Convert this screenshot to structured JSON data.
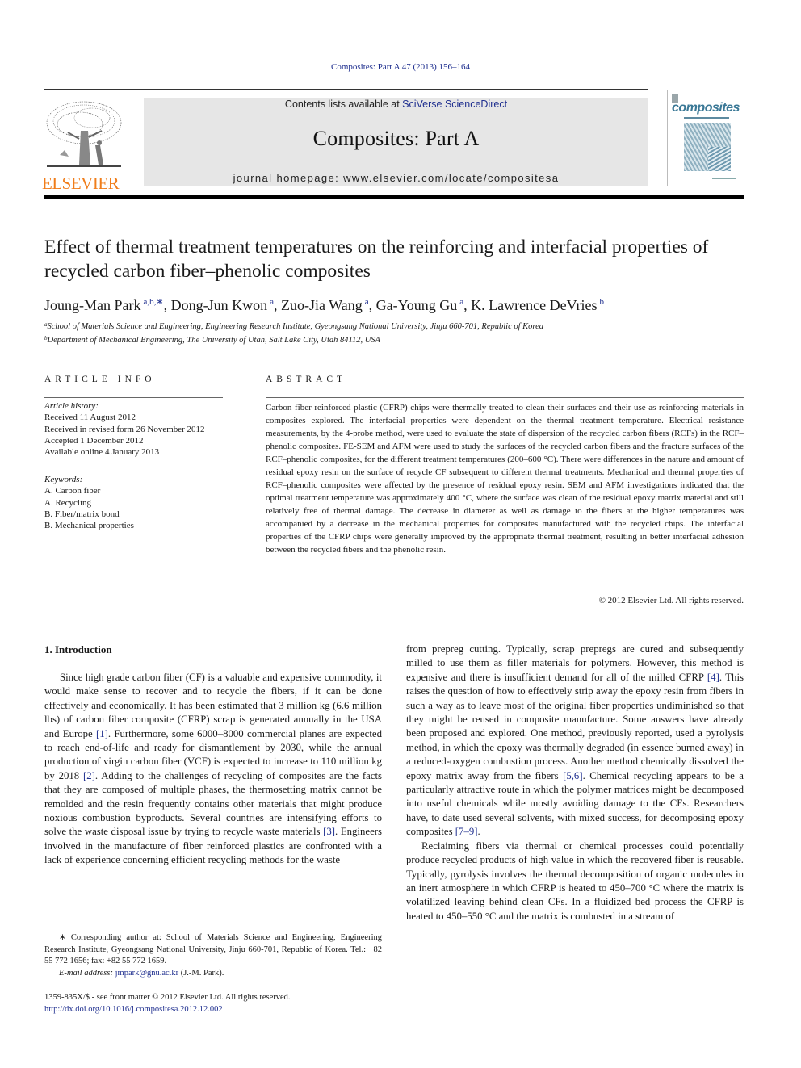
{
  "header": {
    "citation": "Composites: Part A 47 (2013) 156–164",
    "contents_prefix": "Contents lists available at ",
    "contents_link": "SciVerse ScienceDirect",
    "journal_title": "Composites: Part A",
    "homepage_prefix": "journal homepage: ",
    "homepage_url": "www.elsevier.com/locate/compositesa",
    "publisher_logo_text": "ELSEVIER",
    "cover_title": "composites",
    "colors": {
      "link": "#1f2f8f",
      "elsevier_orange": "#f07d1a",
      "masthead_bg": "#e6e6e6",
      "cover_accent": "#3a7896"
    }
  },
  "article": {
    "title": "Effect of thermal treatment temperatures on the reinforcing and interfacial properties of recycled carbon fiber–phenolic composites",
    "authors": [
      {
        "name": "Joung-Man Park",
        "affil": "a,b,∗",
        "sep": ", "
      },
      {
        "name": "Dong-Jun Kwon",
        "affil": "a",
        "sep": ", "
      },
      {
        "name": "Zuo-Jia Wang",
        "affil": "a",
        "sep": ", "
      },
      {
        "name": "Ga-Young Gu",
        "affil": "a",
        "sep": ", "
      },
      {
        "name": "K. Lawrence DeVries",
        "affil": "b",
        "sep": ""
      }
    ],
    "affiliations": [
      {
        "mark": "a",
        "text": "School of Materials Science and Engineering, Engineering Research Institute, Gyeongsang National University, Jinju 660-701, Republic of Korea"
      },
      {
        "mark": "b",
        "text": "Department of Mechanical Engineering, The University of Utah, Salt Lake City, Utah 84112, USA"
      }
    ]
  },
  "article_info": {
    "heading": "ARTICLE INFO",
    "history_label": "Article history:",
    "history": [
      "Received 11 August 2012",
      "Received in revised form 26 November 2012",
      "Accepted 1 December 2012",
      "Available online 4 January 2013"
    ],
    "keywords_label": "Keywords:",
    "keywords": [
      "A. Carbon fiber",
      "A. Recycling",
      "B. Fiber/matrix bond",
      "B. Mechanical properties"
    ]
  },
  "abstract": {
    "heading": "ABSTRACT",
    "text": "Carbon fiber reinforced plastic (CFRP) chips were thermally treated to clean their surfaces and their use as reinforcing materials in composites explored. The interfacial properties were dependent on the thermal treatment temperature. Electrical resistance measurements, by the 4-probe method, were used to eval­uate the state of dispersion of the recycled carbon fibers (RCFs) in the RCF–phenolic composites. FE-SEM and AFM were used to study the surfaces of the recycled carbon fibers and the fracture surfaces of the RCF–phenolic composites, for the different treatment temperatures (200–600 °C). There were differences in the nature and amount of residual epoxy resin on the surface of recycle CF subsequent to different thermal treatments. Mechanical and thermal properties of RCF–phenolic composites were affected by the presence of residual epoxy resin. SEM and AFM investigations indicated that the optimal treatment temperature was approximately 400 °C, where the surface was clean of the residual epoxy matrix mate­rial and still relatively free of thermal damage. The decrease in diameter as well as damage to the fibers at the higher temperatures was accompanied by a decrease in the mechanical properties for composites manufactured with the recycled chips. The interfacial properties of the CFRP chips were generally improved by the appropriate thermal treatment, resulting in better interfacial adhesion between the recycled fibers and the phenolic resin.",
    "copyright": "© 2012 Elsevier Ltd. All rights reserved."
  },
  "introduction": {
    "heading": "1. Introduction",
    "left_paragraph": [
      {
        "t": "Since high grade carbon fiber (CF) is a valuable and expensive commodity, it would make sense to recover and to recycle the fibers, if it can be done effectively and economically. It has been estimated that 3 million kg (6.6 million lbs) of carbon fiber com­posite (CFRP) scrap is generated annually in the USA and Europe "
      },
      {
        "ref": "[1]"
      },
      {
        "t": ". Furthermore, some 6000–8000 commercial planes are ex­pected to reach end-of-life and ready for dismantlement by 2030, while the annual production of virgin carbon fiber (VCF) is ex­pected to increase to 110 million kg by 2018 "
      },
      {
        "ref": "[2]"
      },
      {
        "t": ". Adding to the challenges of recycling of composites are the facts that they are composed of multiple phases, the thermosetting matrix cannot be remolded and the resin frequently contains other materials that might produce noxious combustion byproducts. Several countries are intensifying efforts to solve the waste disposal issue by trying to recycle waste materials "
      },
      {
        "ref": "[3]"
      },
      {
        "t": ". Engineers involved in the manufac­ture of fiber reinforced plastics are confronted with a lack of experience concerning efficient recycling methods for the waste"
      }
    ],
    "right_paragraph_cont": [
      {
        "t": "from prepreg cutting. Typically, scrap prepregs are cured and subsequently milled to use them as filler materials for polymers. However, this method is expensive and there is insufficient de­mand for all of the milled CFRP "
      },
      {
        "ref": "[4]"
      },
      {
        "t": ". This raises the question of how to effectively strip away the epoxy resin from fibers in such a way as to leave most of the original fiber properties undimin­ished so that they might be reused in composite manufacture. Some answers have already been proposed and explored. One method, previously reported, used a pyrolysis method, in which the epoxy was thermally degraded (in essence burned away) in a reduced-oxygen combustion process. Another method chemically dissolved the epoxy matrix away from the fibers "
      },
      {
        "ref": "[5,6]"
      },
      {
        "t": ". Chemical recycling appears to be a particularly attractive route in which the polymer matrices might be decomposed into useful chemicals while mostly avoiding damage to the CFs. Researchers have, to date used several solvents, with mixed success, for decomposing epoxy composites "
      },
      {
        "ref": "[7–9]"
      },
      {
        "t": "."
      }
    ],
    "right_paragraph_2": "Reclaiming fibers via thermal or chemical processes could potentially produce recycled products of high value in which the recovered fiber is reusable. Typically, pyrolysis involves the ther­mal decomposition of organic molecules in an inert atmosphere in which CFRP is heated to 450–700 °C where the matrix is volatil­ized leaving behind clean CFs. In a fluidized bed process the CFRP is heated to 450–550 °C and the matrix is combusted in a stream of"
  },
  "footnote": {
    "corresponding": "∗ Corresponding author at: School of Materials Science and Engineering, Engineering Research Institute, Gyeongsang National University, Jinju 660-701, Republic of Korea. Tel.: +82 55 772 1656; fax: +82 55 772 1659.",
    "email_label": "E-mail address: ",
    "email": "jmpark@gnu.ac.kr",
    "email_suffix": " (J.-M. Park).",
    "front_matter": "1359-835X/$ - see front matter © 2012 Elsevier Ltd. All rights reserved.",
    "doi": "http://dx.doi.org/10.1016/j.compositesa.2012.12.002"
  }
}
